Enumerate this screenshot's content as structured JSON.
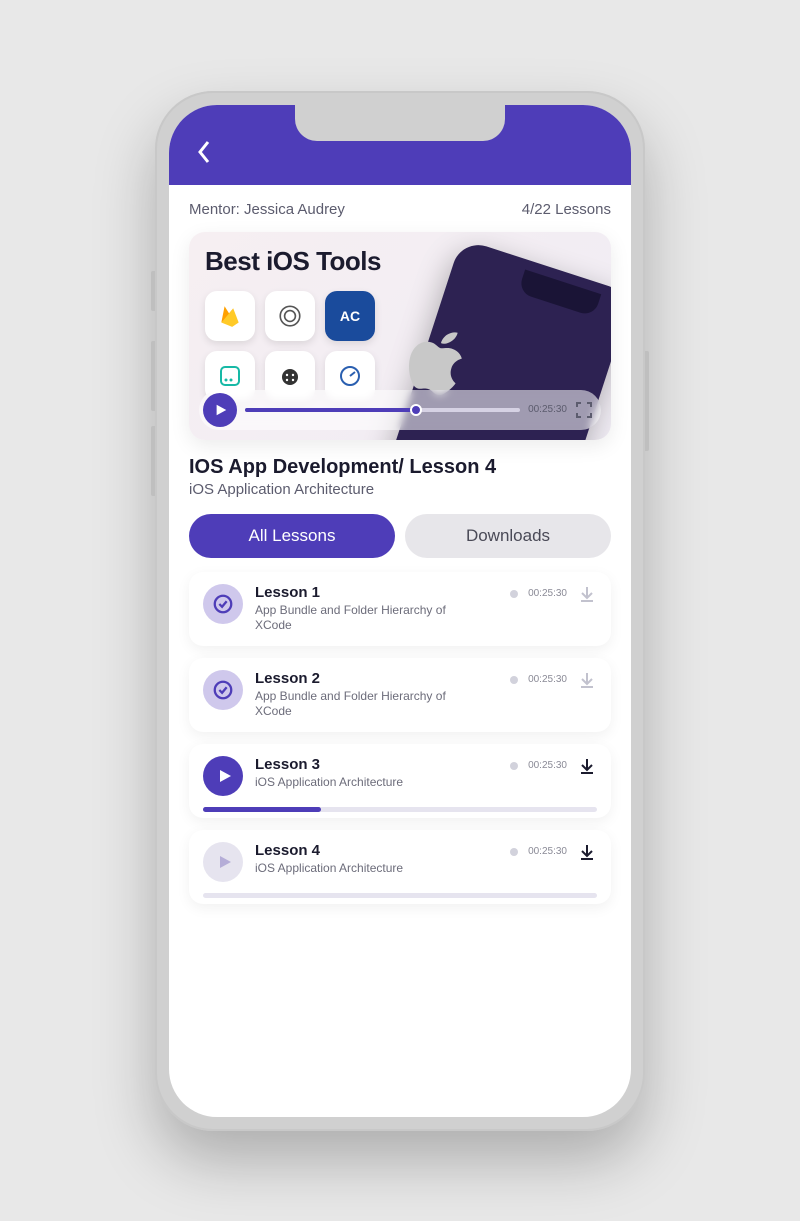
{
  "header": {
    "mentor_label": "Mentor: Jessica Audrey",
    "progress_label": "4/22 Lessons"
  },
  "video": {
    "banner_title": "Best iOS Tools",
    "timestamp": "00:25:30",
    "progress_pct": 62
  },
  "course": {
    "title": "IOS App Development/ Lesson 4",
    "subtitle": "iOS Application Architecture"
  },
  "tabs": {
    "all": "All Lessons",
    "downloads": "Downloads"
  },
  "lessons": [
    {
      "name": "Lesson 1",
      "desc": "App Bundle and Folder Hierarchy of XCode",
      "time": "00:25:30",
      "status": "done",
      "download_style": "light",
      "progress": null
    },
    {
      "name": "Lesson 2",
      "desc": "App Bundle and Folder Hierarchy of XCode",
      "time": "00:25:30",
      "status": "done",
      "download_style": "light",
      "progress": null
    },
    {
      "name": "Lesson 3",
      "desc": "iOS Application Architecture",
      "time": "00:25:30",
      "status": "play",
      "download_style": "dark",
      "progress": 30
    },
    {
      "name": "Lesson 4",
      "desc": "iOS Application Architecture",
      "time": "00:25:30",
      "status": "idle",
      "download_style": "dark",
      "progress": 0
    }
  ],
  "colors": {
    "accent": "#4e3db8"
  }
}
